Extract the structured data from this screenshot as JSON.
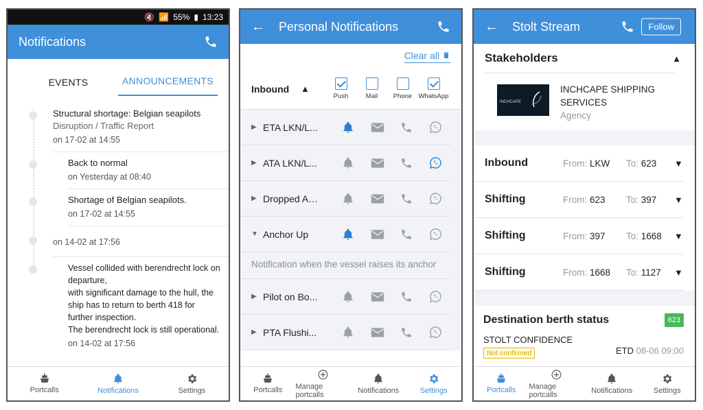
{
  "panel1": {
    "status": {
      "battery": "55%",
      "time": "13:23"
    },
    "title": "Notifications",
    "tabs": [
      "EVENTS",
      "ANNOUNCEMENTS"
    ],
    "entries": [
      {
        "title": "Structural shortage: Belgian seapilots",
        "sub": "Disruption / Traffic Report",
        "date": "on 17-02 at 14:55"
      },
      {
        "title": "Back to normal",
        "date": "on Yesterday at 08:40"
      },
      {
        "title": "Shortage of Belgian seapilots.",
        "date": "on 17-02 at 14:55"
      },
      {
        "date": "on 14-02 at 17:56"
      },
      {
        "body": "Vessel collided with berendrecht lock on departure,\nwith significant damage to the hull, the ship has to return to berth 418 for further inspection.\nThe berendrecht lock is still operational.",
        "date": "on 14-02 at 17:56"
      }
    ],
    "nav": [
      "Portcalls",
      "Notifications",
      "Settings"
    ]
  },
  "panel2": {
    "title": "Personal Notifications",
    "clear_all": "Clear all",
    "section": "Inbound",
    "channels": [
      {
        "label": "Push",
        "checked": true
      },
      {
        "label": "Mail",
        "checked": false
      },
      {
        "label": "Phone",
        "checked": false
      },
      {
        "label": "WhatsApp",
        "checked": true
      }
    ],
    "rows": [
      {
        "name": "ETA LKN/L...",
        "active": [
          true,
          false,
          false,
          false
        ],
        "expanded": false
      },
      {
        "name": "ATA LKN/L...",
        "active": [
          false,
          false,
          false,
          true
        ],
        "expanded": false
      },
      {
        "name": "Dropped An...",
        "active": [
          false,
          false,
          false,
          false
        ],
        "expanded": false
      },
      {
        "name": "Anchor Up",
        "active": [
          true,
          false,
          false,
          false
        ],
        "expanded": true,
        "desc": "Notification when the vessel raises its anchor"
      },
      {
        "name": "Pilot on Bo...",
        "active": [
          false,
          false,
          false,
          false
        ],
        "expanded": false
      },
      {
        "name": "PTA Flushi...",
        "active": [
          false,
          false,
          false,
          false
        ],
        "expanded": false
      }
    ],
    "nav": [
      "Portcalls",
      "Manage portcalls",
      "Notifications",
      "Settings"
    ]
  },
  "panel3": {
    "title": "Stolt Stream",
    "follow": "Follow",
    "stakeholders": "Stakeholders",
    "stakeholder": {
      "name": "INCHCAPE SHIPPING SERVICES",
      "role": "Agency",
      "logo_text": "INCHCAPE"
    },
    "from_label": "From:",
    "to_label": "To:",
    "movements": [
      {
        "type": "Inbound",
        "from": "LKW",
        "to": "623"
      },
      {
        "type": "Shifting",
        "from": "623",
        "to": "397"
      },
      {
        "type": "Shifting",
        "from": "397",
        "to": "1668"
      },
      {
        "type": "Shifting",
        "from": "1668",
        "to": "1127"
      }
    ],
    "dest_title": "Destination berth status",
    "dest_badge": "623",
    "ship": "STOLT CONFIDENCE",
    "confirm": "Not confirmed",
    "etd_label": "ETD",
    "etd_value": "08-06 09:00",
    "nav": [
      "Portcalls",
      "Manage portcalls",
      "Notifications",
      "Settings"
    ]
  },
  "colors": {
    "accent": "#3f8fdb",
    "active_icon": "#2a7fd4",
    "inactive_icon": "#9aa0a6",
    "badge_green": "#49b75a"
  }
}
